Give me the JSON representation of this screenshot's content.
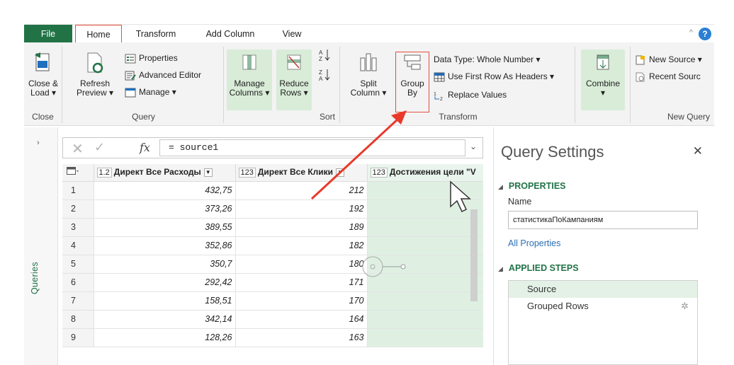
{
  "tabs": {
    "file": "File",
    "home": "Home",
    "transform": "Transform",
    "add_column": "Add Column",
    "view": "View"
  },
  "ribbon": {
    "close_load": [
      "Close &",
      "Load ▾"
    ],
    "close_group": "Close",
    "refresh_preview": [
      "Refresh",
      "Preview ▾"
    ],
    "properties": "Properties",
    "advanced_editor": "Advanced Editor",
    "manage": "Manage ▾",
    "query_group": "Query",
    "manage_columns": [
      "Manage",
      "Columns ▾"
    ],
    "reduce_rows": [
      "Reduce",
      "Rows ▾"
    ],
    "sort_group": "Sort",
    "split_column": [
      "Split",
      "Column ▾"
    ],
    "group_by": [
      "Group",
      "By"
    ],
    "data_type": "Data Type: Whole Number ▾",
    "use_first_row": "Use First Row As Headers ▾",
    "replace_values": "Replace Values",
    "transform_group": "Transform",
    "combine": "Combine",
    "combine_arrow": "▾",
    "new_source": "New Source ▾",
    "recent_sources": "Recent Sourc",
    "new_query_group": "New Query"
  },
  "queries_pane": {
    "label": "Queries",
    "expand_icon": "chevron-right-icon"
  },
  "formula_bar": {
    "cancel": "✕",
    "commit": "✓",
    "fx": "fx",
    "formula": "= source1",
    "expand": "⌄"
  },
  "grid": {
    "columns": [
      {
        "type": "1.2",
        "name": "Директ Все Расходы"
      },
      {
        "type": "123",
        "name": "Директ Все Клики"
      },
      {
        "type": "123",
        "name": "Достижения цели \"V"
      }
    ],
    "rows": [
      {
        "n": "1",
        "cost": "432,75",
        "clicks": "212",
        "goals": ""
      },
      {
        "n": "2",
        "cost": "373,26",
        "clicks": "192",
        "goals": ""
      },
      {
        "n": "3",
        "cost": "389,55",
        "clicks": "189",
        "goals": ""
      },
      {
        "n": "4",
        "cost": "352,86",
        "clicks": "182",
        "goals": ""
      },
      {
        "n": "5",
        "cost": "350,7",
        "clicks": "180",
        "goals": ""
      },
      {
        "n": "6",
        "cost": "292,42",
        "clicks": "171",
        "goals": ""
      },
      {
        "n": "7",
        "cost": "158,51",
        "clicks": "170",
        "goals": ""
      },
      {
        "n": "8",
        "cost": "342,14",
        "clicks": "164",
        "goals": ""
      },
      {
        "n": "9",
        "cost": "128,26",
        "clicks": "163",
        "goals": ""
      }
    ]
  },
  "query_settings": {
    "title": "Query Settings",
    "close": "✕",
    "properties_header": "PROPERTIES",
    "name_label": "Name",
    "name_value": "статистикаПоКампаниям",
    "all_properties": "All Properties",
    "applied_steps_header": "APPLIED STEPS",
    "steps": [
      "Source",
      "Grouped Rows"
    ]
  },
  "colors": {
    "accent_green": "#217346",
    "highlight_red": "#e84c3d",
    "selected_column": "#dff0e3"
  }
}
